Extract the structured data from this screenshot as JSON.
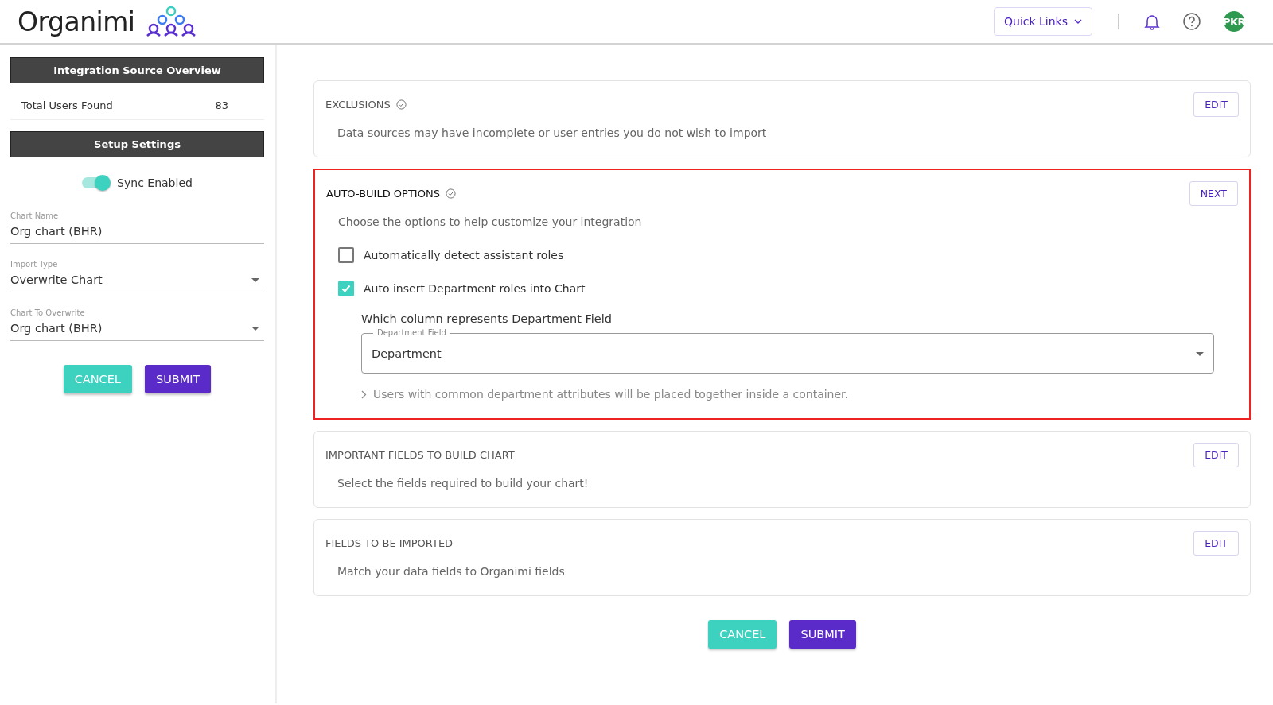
{
  "header": {
    "logo": "Organimi",
    "quick_links": "Quick Links",
    "avatar": "PKR"
  },
  "sidebar": {
    "overview_title": "Integration Source Overview",
    "stats": [
      {
        "label": "Total Users Found",
        "value": "83"
      }
    ],
    "settings_title": "Setup Settings",
    "sync": {
      "label": "Sync Enabled",
      "on": true
    },
    "fields": [
      {
        "kind": "text",
        "label": "Chart Name",
        "value": "Org chart (BHR)"
      },
      {
        "kind": "select",
        "label": "Import Type",
        "value": "Overwrite Chart"
      },
      {
        "kind": "select",
        "label": "Chart To Overwrite",
        "value": "Org chart (BHR)"
      }
    ],
    "buttons": {
      "cancel": "CANCEL",
      "submit": "SUBMIT"
    }
  },
  "sections": [
    {
      "kind": "simple",
      "title": "EXCLUSIONS",
      "complete": true,
      "highlighted": false,
      "description": "Data sources may have incomplete or user entries you do not wish to import",
      "action": "EDIT"
    },
    {
      "kind": "options",
      "title": "AUTO-BUILD OPTIONS",
      "complete": true,
      "highlighted": true,
      "description": "Choose the options to help customize your integration",
      "action": "NEXT",
      "options": [
        {
          "label": "Automatically detect assistant roles",
          "checked": false
        },
        {
          "label": "Auto insert Department roles into Chart",
          "checked": true
        }
      ],
      "question": "Which column represents Department Field",
      "select": {
        "label": "Department Field",
        "value": "Department"
      },
      "hint": "Users with common department attributes will be placed together inside a container."
    },
    {
      "kind": "simple",
      "title": "IMPORTANT FIELDS TO BUILD CHART",
      "complete": false,
      "highlighted": false,
      "description": "Select the fields required to build your chart!",
      "action": "EDIT"
    },
    {
      "kind": "simple",
      "title": "FIELDS TO BE IMPORTED",
      "complete": false,
      "highlighted": false,
      "description": "Match your data fields to Organimi fields",
      "action": "EDIT"
    }
  ],
  "footer_buttons": {
    "cancel": "CANCEL",
    "submit": "SUBMIT"
  }
}
